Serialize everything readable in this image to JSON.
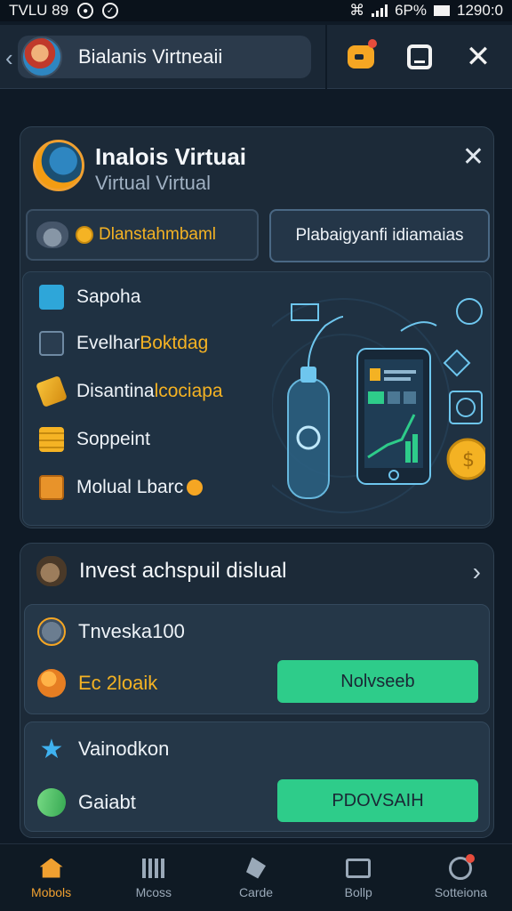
{
  "status_bar": {
    "left_text": "TVLU 89",
    "battery": "6P%",
    "time": "1290:0"
  },
  "header": {
    "title": "Bialanis Virtneaii"
  },
  "main_card": {
    "title": "Inalois Virtuai",
    "subtitle": "Virtual Virtual",
    "tab_left_label": "Dlanstahmbaml",
    "tab_right_label": "Plabaigyanfi idiamaias",
    "features": [
      {
        "label": "Sapoha",
        "highlight": "",
        "icon": "teal-square-icon"
      },
      {
        "label": "Evelhar ",
        "highlight": "Boktdag",
        "icon": "download-icon"
      },
      {
        "label": "Disantina",
        "highlight": "lcociapa",
        "icon": "pencil-icon"
      },
      {
        "label": "Soppeint",
        "highlight": "",
        "icon": "coin-stack-icon"
      },
      {
        "label": "Molual Lbarc",
        "highlight": "",
        "icon": "box-icon"
      }
    ]
  },
  "invest": {
    "title": "Invest achspuil dislual",
    "card1": {
      "row1_label": "Tnveska100",
      "row2_label": "Ec 2loaik",
      "button_label": "Nolvseeb"
    },
    "card2": {
      "row1_label": "Vainodkon",
      "row2_label": "Gaiabt",
      "button_label": "PDOVSAIH"
    }
  },
  "bottom_nav": [
    {
      "label": "Mobols",
      "icon": "home-icon",
      "active": true
    },
    {
      "label": "Mcoss",
      "icon": "grid-icon",
      "active": false
    },
    {
      "label": "Carde",
      "icon": "pen-icon",
      "active": false
    },
    {
      "label": "Bollp",
      "icon": "screen-icon",
      "active": false
    },
    {
      "label": "Sotteiona",
      "icon": "ring-icon",
      "active": false
    }
  ],
  "colors": {
    "accent_gold": "#f4b223",
    "button_green": "#2ecc8a",
    "background": "#0f1a26"
  }
}
